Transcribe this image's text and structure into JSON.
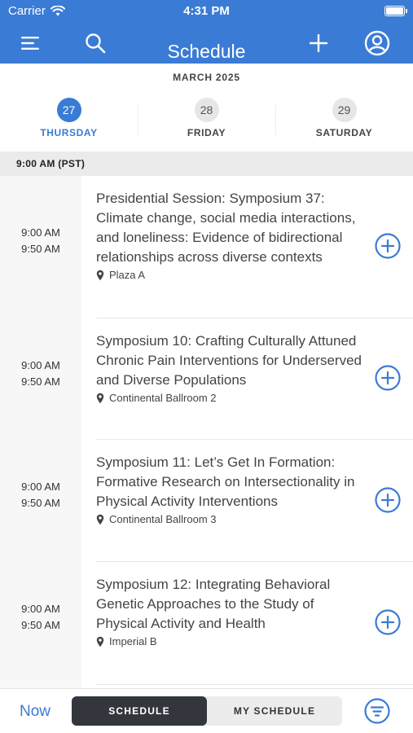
{
  "status_bar": {
    "carrier": "Carrier",
    "time": "4:31 PM"
  },
  "header": {
    "title": "Schedule"
  },
  "calendar": {
    "month": "MARCH 2025",
    "days": [
      {
        "number": "27",
        "label": "THURSDAY",
        "active": true
      },
      {
        "number": "28",
        "label": "FRIDAY",
        "active": false
      },
      {
        "number": "29",
        "label": "SATURDAY",
        "active": false
      }
    ]
  },
  "time_header": "9:00 AM (PST)",
  "sessions": [
    {
      "start": "9:00 AM",
      "end": "9:50 AM",
      "title": "Presidential Session: Symposium 37: Climate change, social media interactions, and loneliness: Evidence of bidirectional relationships across diverse contexts",
      "location": "Plaza A"
    },
    {
      "start": "9:00 AM",
      "end": "9:50 AM",
      "title": "Symposium 10: Crafting Culturally Attuned Chronic Pain Interventions for Underserved and Diverse Populations",
      "location": "Continental Ballroom 2"
    },
    {
      "start": "9:00 AM",
      "end": "9:50 AM",
      "title": "Symposium 11: Let’s Get In Formation: Formative Research on Intersectionality in Physical Activity Interventions",
      "location": "Continental Ballroom 3"
    },
    {
      "start": "9:00 AM",
      "end": "9:50 AM",
      "title": "Symposium 12: Integrating Behavioral Genetic Approaches to the Study of Physical Activity and Health",
      "location": "Imperial B"
    }
  ],
  "bottom_bar": {
    "now_label": "Now",
    "tabs": [
      {
        "label": "SCHEDULE",
        "active": true
      },
      {
        "label": "MY SCHEDULE",
        "active": false
      }
    ]
  },
  "icons": {
    "menu": "menu-icon",
    "search": "search-icon",
    "add": "plus-icon",
    "profile": "profile-icon",
    "location": "location-pin-icon",
    "add_session": "add-circle-icon",
    "filter": "filter-icon"
  },
  "colors": {
    "accent": "#3a7bd5",
    "header_bg": "#3a7bd5",
    "active_segment": "#33373d"
  }
}
